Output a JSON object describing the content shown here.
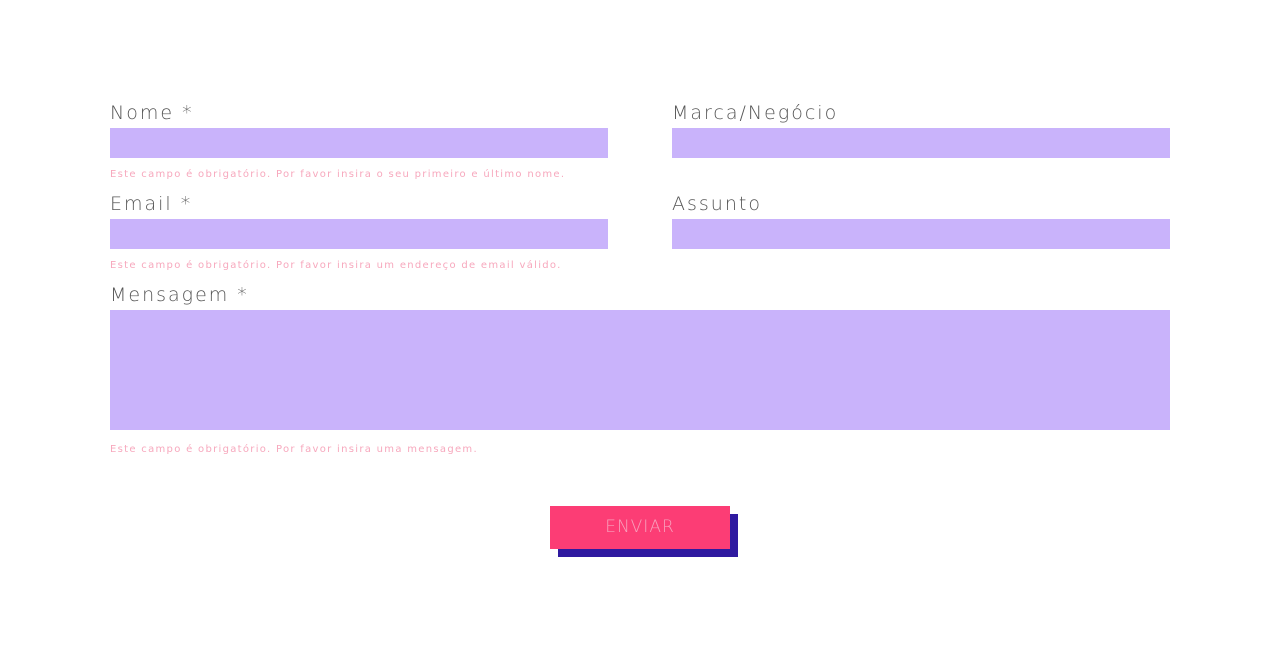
{
  "form": {
    "nome": {
      "label": "Nome *",
      "value": "",
      "error": "Este campo é obrigatório. Por favor insira o seu primeiro e último nome."
    },
    "marca": {
      "label": "Marca/Negócio",
      "value": ""
    },
    "email": {
      "label": "Email *",
      "value": "",
      "error": "Este campo é obrigatório. Por favor insira um endereço de email válido."
    },
    "assunto": {
      "label": "Assunto",
      "value": ""
    },
    "mensagem": {
      "label": "Mensagem *",
      "value": "",
      "error": "Este campo é obrigatório. Por favor insira uma mensagem."
    },
    "submit_label": "ENVIAR"
  },
  "colors": {
    "field_background": "#c9b3fb",
    "button_background": "#fc3d75",
    "button_shadow": "#2f1aa0",
    "error_text": "#f7a8bd",
    "label_text": "#555555"
  }
}
